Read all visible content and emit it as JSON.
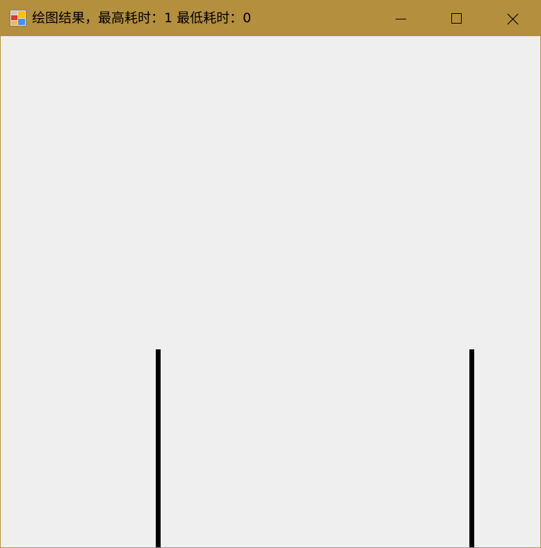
{
  "window": {
    "title": "绘图结果，最高耗时：1 最低耗时：0",
    "icon": "winforms-app-icon",
    "controls": {
      "minimize_icon": "minimize-icon",
      "maximize_icon": "maximize-icon",
      "close_icon": "close-icon"
    }
  },
  "canvas": {
    "line_color": "#000000",
    "background_color": "#efefef"
  },
  "colors": {
    "titlebar": "#b38f3e",
    "border": "#b58f3e"
  }
}
